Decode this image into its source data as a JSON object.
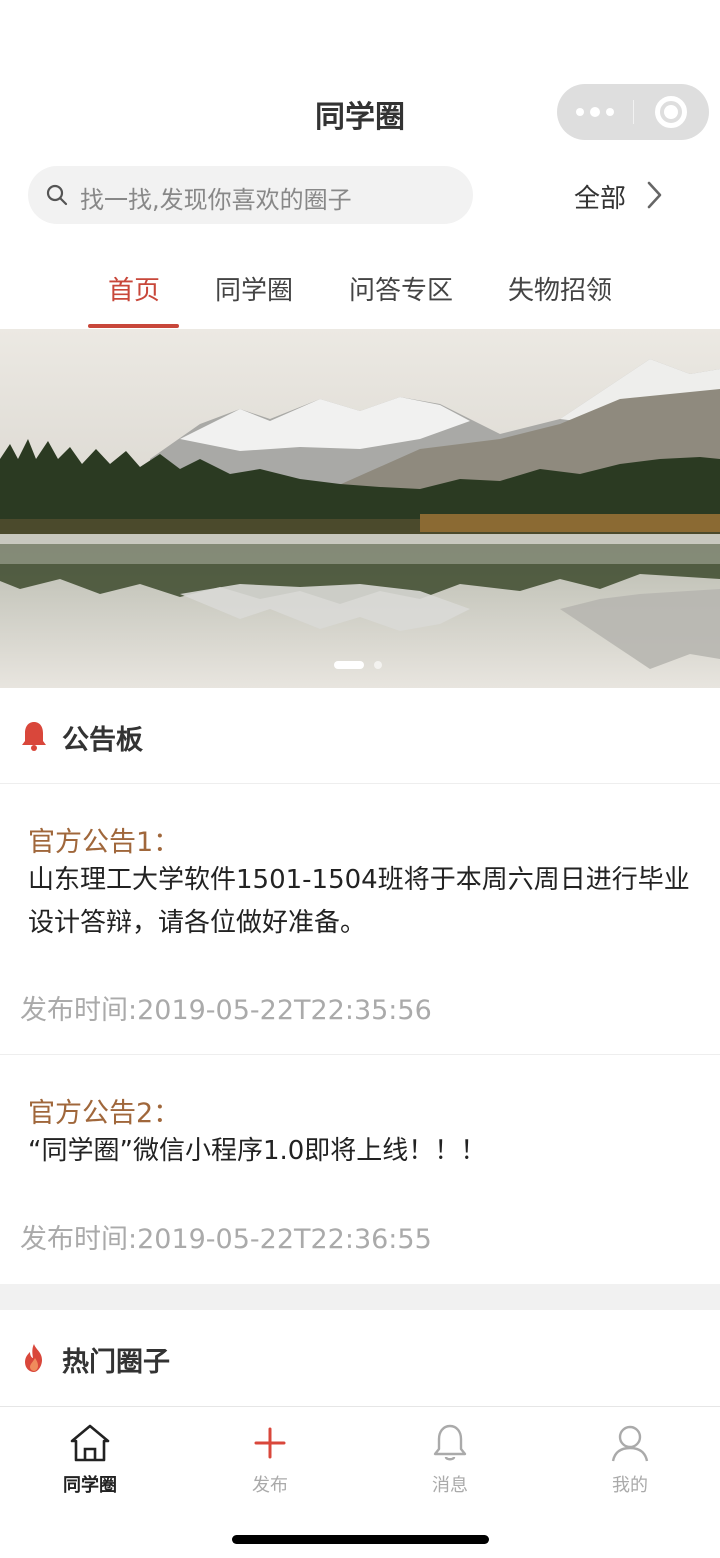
{
  "nav": {
    "title": "同学圈"
  },
  "search": {
    "placeholder": "找一找,发现你喜欢的圈子",
    "all_label": "全部"
  },
  "tabs": [
    {
      "label": "首页",
      "active": true
    },
    {
      "label": "同学圈",
      "active": false
    },
    {
      "label": "问答专区",
      "active": false
    },
    {
      "label": "失物招领",
      "active": false
    }
  ],
  "banner": {
    "current_slide": 1,
    "total_slides": 2
  },
  "bulletin": {
    "title": "公告板",
    "notices": [
      {
        "title": "官方公告1：",
        "body": "山东理工大学软件1501-1504班将于本周六周日进行毕业设计答辩，请各位做好准备。",
        "time": "发布时间:2019-05-22T22:35:56"
      },
      {
        "title": "官方公告2：",
        "body": "“同学圈”微信小程序1.0即将上线！！！",
        "time": "发布时间:2019-05-22T22:36:55"
      }
    ]
  },
  "hot": {
    "title": "热门圈子"
  },
  "tabbar": [
    {
      "label": "同学圈",
      "icon": "home-icon",
      "active": true
    },
    {
      "label": "发布",
      "icon": "plus-icon",
      "active": false
    },
    {
      "label": "消息",
      "icon": "bell-icon",
      "active": false
    },
    {
      "label": "我的",
      "icon": "user-icon",
      "active": false
    }
  ],
  "colors": {
    "accent": "#c8473a",
    "notice_title": "#a0673b",
    "muted": "#aaaaaa"
  }
}
